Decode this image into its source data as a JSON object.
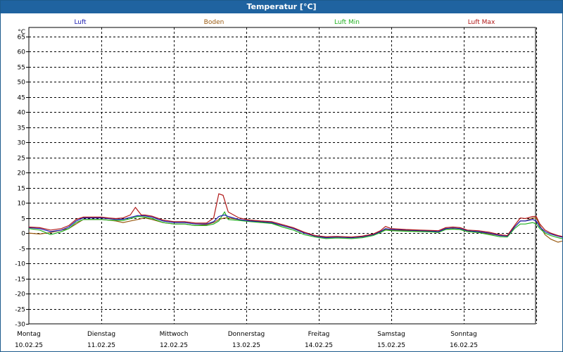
{
  "window": {
    "title": "Temperatur [°C]"
  },
  "chart_data": {
    "type": "line",
    "ylabel": "°C",
    "ylim": [
      -30,
      68
    ],
    "yticks": [
      65,
      60,
      55,
      50,
      45,
      40,
      35,
      30,
      25,
      20,
      15,
      10,
      5,
      0,
      -5,
      -10,
      -15,
      -20,
      -25,
      -30
    ],
    "xlim": [
      0,
      7.15
    ],
    "day_labels": [
      {
        "day": "Montag",
        "date": "10.02.25"
      },
      {
        "day": "Dienstag",
        "date": "11.02.25"
      },
      {
        "day": "Mittwoch",
        "date": "12.02.25"
      },
      {
        "day": "Donnerstag",
        "date": "13.02.25"
      },
      {
        "day": "Freitag",
        "date": "14.02.25"
      },
      {
        "day": "Samstag",
        "date": "15.02.25"
      },
      {
        "day": "Sonntag",
        "date": "16.02.25"
      }
    ],
    "grid": true,
    "series": [
      {
        "name": "Luft",
        "color": "#1b1bb0",
        "points": [
          [
            0,
            1.8
          ],
          [
            0.15,
            1.5
          ],
          [
            0.3,
            0.5
          ],
          [
            0.45,
            1
          ],
          [
            0.55,
            2
          ],
          [
            0.65,
            4
          ],
          [
            0.75,
            5
          ],
          [
            0.9,
            5
          ],
          [
            1.0,
            5
          ],
          [
            1.1,
            4.8
          ],
          [
            1.2,
            4.5
          ],
          [
            1.3,
            4.6
          ],
          [
            1.4,
            5.2
          ],
          [
            1.5,
            5.8
          ],
          [
            1.6,
            5.7
          ],
          [
            1.7,
            5.3
          ],
          [
            1.85,
            4
          ],
          [
            2.0,
            3.5
          ],
          [
            2.15,
            3.5
          ],
          [
            2.3,
            3
          ],
          [
            2.45,
            3
          ],
          [
            2.55,
            3.8
          ],
          [
            2.62,
            5.5
          ],
          [
            2.7,
            6
          ],
          [
            2.75,
            5.5
          ],
          [
            2.9,
            4.5
          ],
          [
            3.05,
            4
          ],
          [
            3.2,
            3.8
          ],
          [
            3.35,
            3.5
          ],
          [
            3.5,
            2.5
          ],
          [
            3.65,
            1.5
          ],
          [
            3.8,
            0
          ],
          [
            3.95,
            -1
          ],
          [
            4.1,
            -1.5
          ],
          [
            4.25,
            -1.3
          ],
          [
            4.45,
            -1.5
          ],
          [
            4.6,
            -1.2
          ],
          [
            4.75,
            -0.5
          ],
          [
            4.85,
            0.5
          ],
          [
            4.92,
            1.5
          ],
          [
            5.0,
            1.2
          ],
          [
            5.2,
            1.0
          ],
          [
            5.4,
            0.8
          ],
          [
            5.55,
            0.7
          ],
          [
            5.65,
            0.5
          ],
          [
            5.75,
            1.5
          ],
          [
            5.85,
            1.7
          ],
          [
            5.95,
            1.5
          ],
          [
            6.05,
            0.8
          ],
          [
            6.2,
            0.5
          ],
          [
            6.35,
            0
          ],
          [
            6.5,
            -0.8
          ],
          [
            6.6,
            -1
          ],
          [
            6.7,
            2
          ],
          [
            6.78,
            4
          ],
          [
            6.85,
            4
          ],
          [
            6.95,
            4.5
          ],
          [
            7.0,
            4
          ],
          [
            7.05,
            2
          ],
          [
            7.12,
            0.5
          ],
          [
            7.2,
            -0.3
          ],
          [
            7.3,
            -1
          ],
          [
            7.38,
            -1.5
          ]
        ]
      },
      {
        "name": "Boden",
        "color": "#9a5a10",
        "points": [
          [
            0,
            0
          ],
          [
            0.15,
            -0.3
          ],
          [
            0.3,
            0.2
          ],
          [
            0.45,
            1
          ],
          [
            0.55,
            1.5
          ],
          [
            0.65,
            3
          ],
          [
            0.75,
            4.5
          ],
          [
            0.9,
            4.5
          ],
          [
            1.0,
            4.5
          ],
          [
            1.1,
            4.3
          ],
          [
            1.2,
            4
          ],
          [
            1.3,
            3.5
          ],
          [
            1.4,
            4
          ],
          [
            1.5,
            4.5
          ],
          [
            1.6,
            5
          ],
          [
            1.7,
            4.5
          ],
          [
            1.85,
            3.5
          ],
          [
            2.0,
            3
          ],
          [
            2.15,
            3
          ],
          [
            2.3,
            2.5
          ],
          [
            2.45,
            2.8
          ],
          [
            2.55,
            3.5
          ],
          [
            2.62,
            4.5
          ],
          [
            2.7,
            5
          ],
          [
            2.75,
            5
          ],
          [
            2.9,
            4.5
          ],
          [
            3.05,
            4
          ],
          [
            3.2,
            3.8
          ],
          [
            3.35,
            3.3
          ],
          [
            3.5,
            2.5
          ],
          [
            3.65,
            1.5
          ],
          [
            3.8,
            0
          ],
          [
            3.95,
            -1
          ],
          [
            4.1,
            -1.3
          ],
          [
            4.25,
            -1.2
          ],
          [
            4.45,
            -1.4
          ],
          [
            4.6,
            -1.2
          ],
          [
            4.75,
            -0.5
          ],
          [
            4.85,
            0.5
          ],
          [
            4.92,
            1.2
          ],
          [
            5.0,
            1
          ],
          [
            5.2,
            0.8
          ],
          [
            5.4,
            0.6
          ],
          [
            5.55,
            0.5
          ],
          [
            5.65,
            0.5
          ],
          [
            5.75,
            1.2
          ],
          [
            5.85,
            1.4
          ],
          [
            5.95,
            1.2
          ],
          [
            6.05,
            0.5
          ],
          [
            6.2,
            0.3
          ],
          [
            6.35,
            -0.2
          ],
          [
            6.5,
            -0.8
          ],
          [
            6.6,
            -0.8
          ],
          [
            6.7,
            2
          ],
          [
            6.78,
            4
          ],
          [
            6.85,
            4
          ],
          [
            6.95,
            5
          ],
          [
            7.0,
            5
          ],
          [
            7.05,
            2.5
          ],
          [
            7.12,
            -0.5
          ],
          [
            7.2,
            -2
          ],
          [
            7.3,
            -3
          ],
          [
            7.38,
            -2.5
          ]
        ]
      },
      {
        "name": "Luft Min",
        "color": "#22b122",
        "points": [
          [
            0,
            1.5
          ],
          [
            0.15,
            1
          ],
          [
            0.3,
            -0.5
          ],
          [
            0.45,
            0.5
          ],
          [
            0.55,
            1.5
          ],
          [
            0.65,
            3.5
          ],
          [
            0.75,
            4.5
          ],
          [
            0.9,
            4.5
          ],
          [
            1.0,
            4.5
          ],
          [
            1.1,
            4.3
          ],
          [
            1.2,
            4.2
          ],
          [
            1.3,
            4.2
          ],
          [
            1.4,
            4.8
          ],
          [
            1.5,
            5.5
          ],
          [
            1.6,
            5.3
          ],
          [
            1.7,
            4.8
          ],
          [
            1.85,
            3.5
          ],
          [
            2.0,
            3
          ],
          [
            2.15,
            3
          ],
          [
            2.3,
            2.5
          ],
          [
            2.45,
            2.5
          ],
          [
            2.55,
            3
          ],
          [
            2.62,
            4
          ],
          [
            2.7,
            7
          ],
          [
            2.75,
            4.5
          ],
          [
            2.9,
            4.2
          ],
          [
            3.05,
            3.8
          ],
          [
            3.2,
            3.5
          ],
          [
            3.35,
            3.2
          ],
          [
            3.5,
            2
          ],
          [
            3.65,
            1
          ],
          [
            3.8,
            -0.5
          ],
          [
            3.95,
            -1.3
          ],
          [
            4.1,
            -1.8
          ],
          [
            4.25,
            -1.6
          ],
          [
            4.45,
            -1.8
          ],
          [
            4.6,
            -1.5
          ],
          [
            4.75,
            -0.8
          ],
          [
            4.85,
            0.2
          ],
          [
            4.92,
            1
          ],
          [
            5.0,
            0.8
          ],
          [
            5.2,
            0.6
          ],
          [
            5.4,
            0.5
          ],
          [
            5.55,
            0.4
          ],
          [
            5.65,
            0.2
          ],
          [
            5.75,
            1.2
          ],
          [
            5.85,
            1.3
          ],
          [
            5.95,
            1.2
          ],
          [
            6.05,
            0.5
          ],
          [
            6.2,
            0.2
          ],
          [
            6.35,
            -0.5
          ],
          [
            6.5,
            -1.2
          ],
          [
            6.6,
            -1.3
          ],
          [
            6.7,
            1.5
          ],
          [
            6.78,
            3
          ],
          [
            6.85,
            3
          ],
          [
            6.95,
            3.5
          ],
          [
            7.0,
            3
          ],
          [
            7.05,
            1.5
          ],
          [
            7.12,
            0
          ],
          [
            7.2,
            -0.8
          ],
          [
            7.3,
            -1.5
          ],
          [
            7.38,
            -2
          ]
        ]
      },
      {
        "name": "Luft Max",
        "color": "#b01818",
        "points": [
          [
            0,
            2
          ],
          [
            0.15,
            1.8
          ],
          [
            0.3,
            1
          ],
          [
            0.45,
            1.5
          ],
          [
            0.55,
            2.5
          ],
          [
            0.65,
            4.5
          ],
          [
            0.75,
            5.3
          ],
          [
            0.9,
            5.3
          ],
          [
            1.0,
            5.3
          ],
          [
            1.1,
            5
          ],
          [
            1.2,
            4.8
          ],
          [
            1.3,
            5
          ],
          [
            1.4,
            6
          ],
          [
            1.47,
            8.5
          ],
          [
            1.55,
            6
          ],
          [
            1.6,
            6
          ],
          [
            1.7,
            5.6
          ],
          [
            1.85,
            4.3
          ],
          [
            2.0,
            3.8
          ],
          [
            2.15,
            3.8
          ],
          [
            2.3,
            3.3
          ],
          [
            2.45,
            3.3
          ],
          [
            2.55,
            5
          ],
          [
            2.62,
            13
          ],
          [
            2.68,
            12.5
          ],
          [
            2.75,
            7
          ],
          [
            2.9,
            5
          ],
          [
            3.05,
            4.3
          ],
          [
            3.2,
            4
          ],
          [
            3.35,
            3.8
          ],
          [
            3.5,
            2.8
          ],
          [
            3.65,
            1.8
          ],
          [
            3.8,
            0.3
          ],
          [
            3.95,
            -0.8
          ],
          [
            4.1,
            -1.2
          ],
          [
            4.25,
            -1.1
          ],
          [
            4.45,
            -1.3
          ],
          [
            4.6,
            -1
          ],
          [
            4.75,
            -0.3
          ],
          [
            4.85,
            0.8
          ],
          [
            4.92,
            2.2
          ],
          [
            5.0,
            1.5
          ],
          [
            5.2,
            1.2
          ],
          [
            5.4,
            1
          ],
          [
            5.55,
            0.9
          ],
          [
            5.65,
            0.8
          ],
          [
            5.75,
            1.8
          ],
          [
            5.85,
            2
          ],
          [
            5.95,
            1.8
          ],
          [
            6.05,
            1
          ],
          [
            6.2,
            0.8
          ],
          [
            6.35,
            0.3
          ],
          [
            6.5,
            -0.5
          ],
          [
            6.6,
            -0.8
          ],
          [
            6.7,
            2.5
          ],
          [
            6.78,
            5
          ],
          [
            6.85,
            4.8
          ],
          [
            6.95,
            5.5
          ],
          [
            7.0,
            5.5
          ],
          [
            7.05,
            3
          ],
          [
            7.12,
            1
          ],
          [
            7.2,
            0
          ],
          [
            7.3,
            -0.8
          ],
          [
            7.38,
            -1.2
          ]
        ]
      }
    ]
  }
}
